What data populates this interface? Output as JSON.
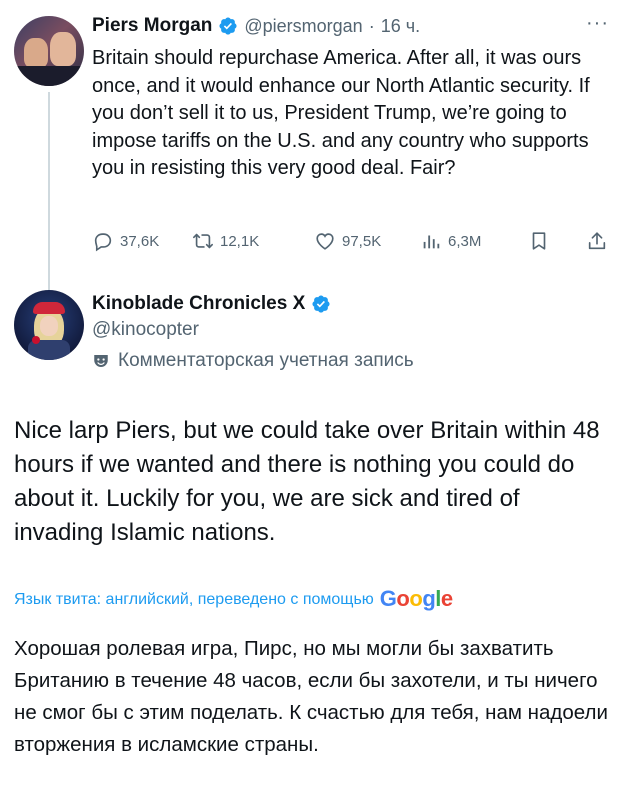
{
  "tweet": {
    "author_name": "Piers Morgan",
    "handle": "@piersmorgan",
    "separator": "·",
    "time": "16 ч.",
    "more_label": "···",
    "text": "Britain should repurchase America. After all, it was ours once, and it would enhance our North Atlantic security. If you don’t sell it to us, President Trump, we’re going to impose tariffs on the U.S. and any country who supports you in resisting this very good deal. Fair?",
    "replies": "37,6K",
    "retweets": "12,1K",
    "likes": "97,5K",
    "views": "6,3M"
  },
  "reply": {
    "author_name": "Kinoblade Chronicles X",
    "handle": "@kinocopter",
    "account_label": "Комментаторская учетная запись",
    "text": "Nice larp Piers, but we could take over Britain within 48 hours if we wanted and there is nothing you could do about it. Luckily for you, we are sick and tired of invading Islamic nations.",
    "translation_note": "Язык твита: английский, переведено с помощью",
    "translation_brand": [
      "G",
      "o",
      "o",
      "g",
      "l",
      "e"
    ],
    "translated_text": "Хорошая ролевая игра, Пирс, но мы могли бы захватить Британию в течение 48 часов, если бы захотели, и ты ничего не смог бы с этим поделать. К счастью для тебя, нам надоели вторжения в исламские страны."
  },
  "colors": {
    "accent": "#1d9bf0",
    "muted": "#536471",
    "google": [
      "#4285F4",
      "#EA4335",
      "#FBBC05",
      "#4285F4",
      "#34A853",
      "#EA4335"
    ]
  }
}
